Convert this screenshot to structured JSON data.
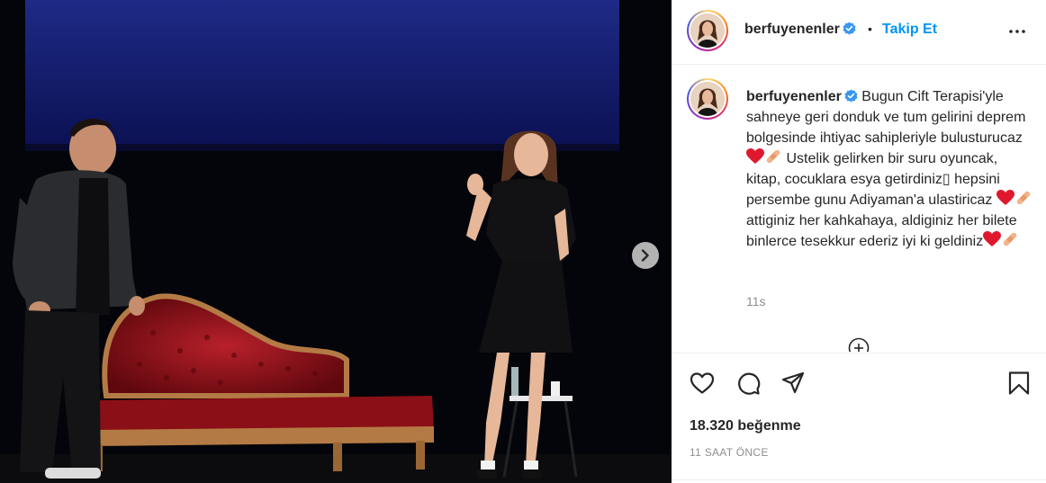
{
  "post": {
    "username": "berfuyenenler",
    "separator": "•",
    "follow_label": "Takip Et",
    "caption": "Bugun Cift Terapisi'yle sahneye geri donduk ve tum gelirini deprem bolgesinde ihtiyac sahipleriyle bulusturucaz",
    "caption_2": " Ustelik gelirken bir suru oyuncak, kitap, cocuklara esya getirdiniz▯ hepsini persembe gunu Adiyaman'a ulastiricaz",
    "caption_3": " attiginiz her kahkahaya, aldiginiz her bilete binlerce tesekkur ederiz iyi ki geldiniz",
    "time_short": "11s",
    "likes": "18.320 beğenme",
    "time_long": "11 SAAT ÖNCE"
  },
  "icons": {
    "verified": "verified-badge-icon",
    "more": "more-horizontal-icon",
    "like": "heart-icon",
    "comment": "comment-icon",
    "share": "send-icon",
    "save": "bookmark-icon",
    "next": "chevron-right-icon",
    "emoji": [
      "red-heart-emoji",
      "adhesive-bandage-emoji"
    ]
  },
  "colors": {
    "accent": "#0095f6",
    "text": "#262626",
    "muted": "#8e8e8e",
    "verified": "#3897f0"
  }
}
